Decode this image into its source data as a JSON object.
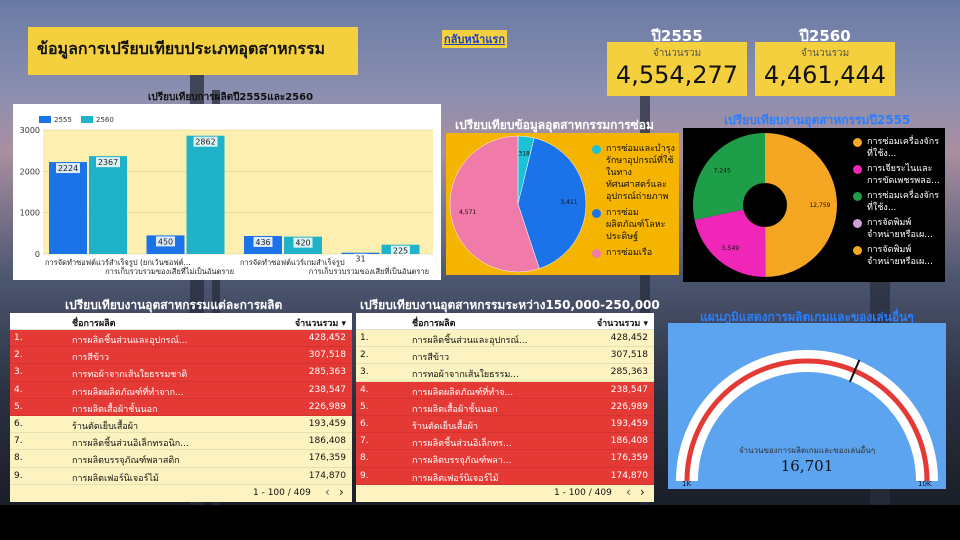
{
  "header": {
    "title": "ข้อมูลการเปรียบเทียบประเภทอุตสาหกรรม",
    "back_link": "กลับหน้าแรก"
  },
  "kpis": [
    {
      "year": "ปี2555",
      "label": "จำนวนรวม",
      "value": "4,554,277"
    },
    {
      "year": "ปี2560",
      "label": "จำนวนรวม",
      "value": "4,461,444"
    }
  ],
  "chart_data": [
    {
      "type": "bar",
      "title": "เปรียบเทียบการผลิตปี2555และ2560",
      "categories": [
        "การจัดทำซอฟต์แวร์สำเร็จรูป (ยกเว้นซอฟต์...",
        "การเก็บรวบรวมของเสียที่ไม่เป็นอันตราย",
        "การจัดทำซอฟต์แวร์เกมสำเร็จรูป",
        "การเก็บรวบรวมของเสียที่เป็นอันตราย"
      ],
      "series": [
        {
          "name": "2555",
          "values": [
            2224,
            450,
            436,
            31
          ],
          "color": "#1a73e8"
        },
        {
          "name": "2560",
          "values": [
            2367,
            2862,
            420,
            225
          ],
          "color": "#20b2c8"
        }
      ],
      "ylim": [
        0,
        3000
      ],
      "yticks": [
        "0",
        "1000",
        "2000",
        "3000"
      ],
      "grid": true,
      "legend": "top-left"
    },
    {
      "type": "pie",
      "title": "เปรียบเทียบข้อมูลอุตสาหกรรมการซ่อม",
      "slices": [
        {
          "label": "การซ่อมและบำรุงรักษาอุปกรณ์ที่ใช้ในทางทัศนศาสตร์และอุปกรณ์ถ่ายภาพ",
          "value": 318,
          "display": "318",
          "color": "#1bc1d6"
        },
        {
          "label": "การซ่อมผลิตภัณฑ์โลหะประดิษฐ์",
          "value": 3411,
          "display": "3,411",
          "color": "#1a73e8"
        },
        {
          "label": "การซ่อมเรือ",
          "value": 4571,
          "display": "4,571",
          "color": "#f07aa8"
        }
      ],
      "legend": "right"
    },
    {
      "type": "pie",
      "title": "เปรียบเทียบงานอุตสาหกรรมปี2555",
      "donut": true,
      "slices": [
        {
          "label": "การซ่อมเครื่องจักรที่ใช้ง...",
          "value": 12759,
          "display": "12,759",
          "color": "#f5a623"
        },
        {
          "label": "การเจียระไนและการขัดเพชรพลอ...",
          "value": 5549,
          "display": "5,549",
          "color": "#f026b8"
        },
        {
          "label": "การซ่อมเครื่องจักรที่ใช้ง...",
          "value": 7245,
          "display": "7,245",
          "color": "#1e9e48"
        }
      ],
      "legend_items": [
        {
          "label": "การซ่อมเครื่องจักรที่ใช้ง...",
          "color": "#f5a623"
        },
        {
          "label": "การเจียระไนและการขัดเพชรพลอ...",
          "color": "#f026b8"
        },
        {
          "label": "การซ่อมเครื่องจักรที่ใช้ง...",
          "color": "#1e9e48"
        },
        {
          "label": "การจัดพิมพ์จำหน่ายหรือเผ...",
          "color": "#cfa0d8"
        },
        {
          "label": "การจัดพิมพ์จำหน่ายหรือเผ...",
          "color": "#f5a623"
        }
      ],
      "legend": "right"
    },
    {
      "type": "gauge",
      "title": "แผนภูมิแสดงการผลิตเกมและของเล่นอื่นๆ",
      "label": "จำนวนของการผลิตเกมและของเล่นอื่นๆ",
      "value": 16701,
      "display": "16,701",
      "min_label": "1K",
      "max_label": "10K"
    }
  ],
  "tables": [
    {
      "title": "เปรียบเทียบงานอุตสาหกรรมแต่ละการผลิต",
      "col_name": "ชื่อการผลิต",
      "col_total": "จำนวนรวม",
      "rows": [
        {
          "idx": "1.",
          "name": "การผลิตชิ้นส่วนและอุปกรณ์...",
          "value": "428,452"
        },
        {
          "idx": "2.",
          "name": "การสีข้าว",
          "value": "307,518"
        },
        {
          "idx": "3.",
          "name": "การทอผ้าจากเส้นใยธรรมชาติ",
          "value": "285,363"
        },
        {
          "idx": "4.",
          "name": "การผลิตผลิตภัณฑ์ที่ทำจาก...",
          "value": "238,547"
        },
        {
          "idx": "5.",
          "name": "การผลิตเสื้อผ้าชั้นนอก",
          "value": "226,989"
        },
        {
          "idx": "6.",
          "name": "ร้านตัดเย็บเสื้อผ้า",
          "value": "193,459"
        },
        {
          "idx": "7.",
          "name": "การผลิตชิ้นส่วนอิเล็กทรอนิก...",
          "value": "186,408"
        },
        {
          "idx": "8.",
          "name": "การผลิตบรรจุภัณฑ์พลาสติก",
          "value": "176,359"
        },
        {
          "idx": "9.",
          "name": "การผลิตเฟอร์นิเจอร์ไม้",
          "value": "174,870"
        }
      ],
      "red_rows": 5,
      "pager": "1 - 100 / 409"
    },
    {
      "title": "เปรียบเทียบงานอุตสาหกรรมระหว่าง150,000-250,000",
      "col_name": "ชื่อการผลิต",
      "col_total": "จำนวนรวม",
      "rows": [
        {
          "idx": "1.",
          "name": "การผลิตชิ้นส่วนและอุปกรณ์...",
          "value": "428,452"
        },
        {
          "idx": "2.",
          "name": "การสีข้าว",
          "value": "307,518"
        },
        {
          "idx": "3.",
          "name": "การทอผ้าจากเส้นใยธรรม...",
          "value": "285,363"
        },
        {
          "idx": "4.",
          "name": "การผลิตผลิตภัณฑ์ที่ทำจ...",
          "value": "238,547"
        },
        {
          "idx": "5.",
          "name": "การผลิตเสื้อผ้าชั้นนอก",
          "value": "226,989"
        },
        {
          "idx": "6.",
          "name": "ร้านตัดเย็บเสื้อผ้า",
          "value": "193,459"
        },
        {
          "idx": "7.",
          "name": "การผลิตชิ้นส่วนอิเล็กทร...",
          "value": "186,408"
        },
        {
          "idx": "8.",
          "name": "การผลิตบรรจุภัณฑ์พลา...",
          "value": "176,359"
        },
        {
          "idx": "9.",
          "name": "การผลิตเฟอร์นิเจอร์ไม้",
          "value": "174,870"
        }
      ],
      "red_rows_from": 4,
      "pager": "1 - 100 / 409"
    }
  ]
}
